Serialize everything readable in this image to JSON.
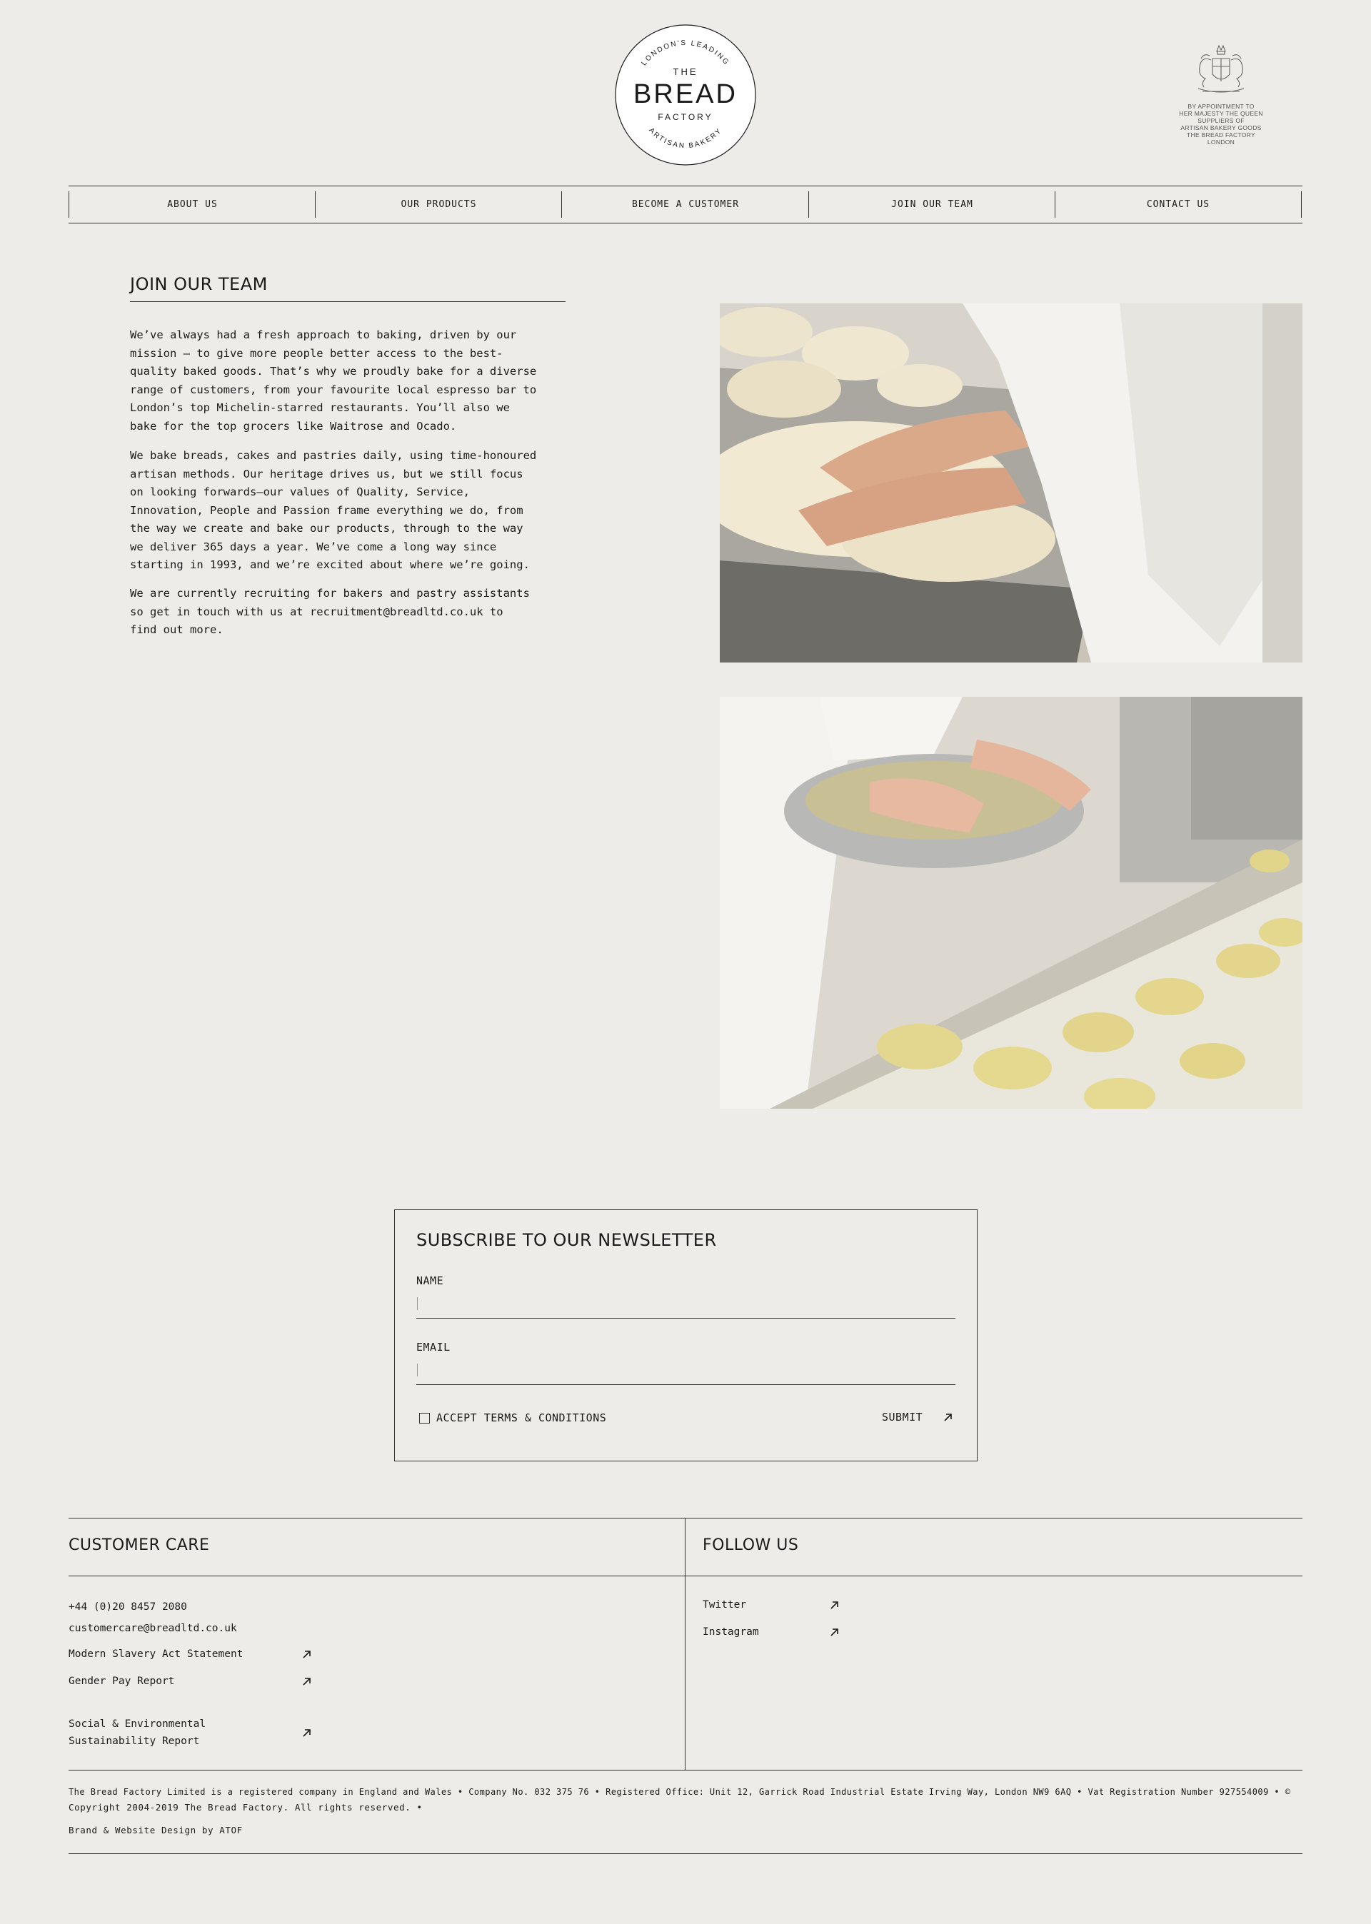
{
  "logo": {
    "top_arc": "LONDON'S LEADING",
    "line1": "THE",
    "line2": "BREAD",
    "line3": "FACTORY",
    "bottom_arc": "ARTISAN BAKERY"
  },
  "crest": {
    "icon": "royal-coat-of-arms-icon",
    "lines": [
      "BY APPOINTMENT TO",
      "HER MAJESTY THE QUEEN",
      "SUPPLIERS OF",
      "ARTISAN BAKERY GOODS",
      "THE BREAD FACTORY",
      "LONDON"
    ]
  },
  "nav": {
    "items": [
      "ABOUT US",
      "OUR PRODUCTS",
      "BECOME A CUSTOMER",
      "JOIN OUR TEAM",
      "CONTACT US"
    ]
  },
  "main": {
    "title": "JOIN OUR TEAM",
    "paragraphs": [
      [
        "We’ve always had a fresh approach to baking, driven by our",
        "mission – to give more people better access to the best-",
        "quality baked goods. That’s why we proudly bake for a diverse",
        "range of customers, from your favourite local espresso bar to",
        "London’s top Michelin-starred restaurants. You’ll also we",
        "bake for the top grocers like Waitrose and Ocado."
      ],
      [
        "We bake breads, cakes and pastries daily, using time-honoured",
        "artisan methods. Our heritage drives us, but we still focus",
        "on looking forwards–our values of Quality, Service,",
        "Innovation, People and Passion frame everything we do, from",
        "the way we create and bake our products, through to the way",
        "we deliver 365 days a year. We’ve come a long way since",
        "starting in 1993, and we’re excited about where we’re going."
      ],
      [
        "We are currently recruiting for bakers and pastry assistants",
        "so get in touch with us at recruitment@breadltd.co.uk  to",
        "find out more."
      ]
    ],
    "images": [
      "baker-kneading-dough-photo",
      "baker-seeding-rolls-photo"
    ]
  },
  "newsletter": {
    "title": "SUBSCRIBE TO OUR NEWSLETTER",
    "name_label": "NAME",
    "name_value": "",
    "email_label": "EMAIL",
    "email_value": "",
    "terms_label": "ACCEPT TERMS & CONDITIONS",
    "submit_label": "SUBMIT"
  },
  "footer": {
    "customer_care": {
      "heading": "CUSTOMER CARE",
      "phone": "+44 (0)20 8457 2080",
      "email": "customercare@breadltd.co.uk",
      "links": [
        "Modern Slavery Act Statement",
        "Gender Pay Report"
      ],
      "report_lines": [
        "Social & Environmental",
        "Sustainability Report"
      ]
    },
    "follow_us": {
      "heading": "FOLLOW US",
      "links": [
        "Twitter",
        "Instagram"
      ]
    },
    "legal_line1": "The Bread Factory Limited is a registered company in England and Wales • Company No. 032 375 76 • Registered Office: Unit 12, Garrick Road Industrial Estate Irving Way, London NW9 6AQ • Vat Registration Number 927554009 • ©",
    "legal_line2": "Copyright 2004-2019 The Bread Factory. All rights reserved. •",
    "credit": "Brand & Website Design by ATOF"
  },
  "colors": {
    "background": "#edece8",
    "text": "#1a1a1a",
    "rule": "#333333"
  }
}
